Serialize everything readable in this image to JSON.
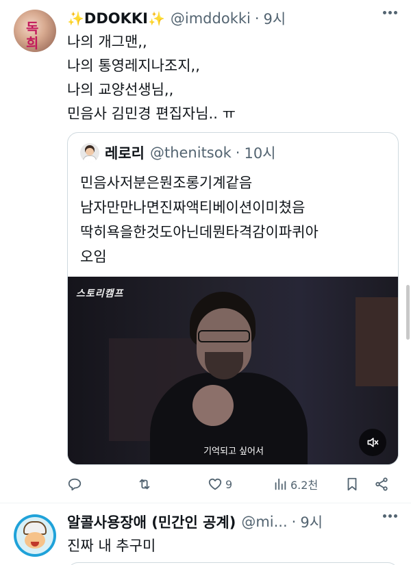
{
  "tweet1": {
    "name": "DDOKKI",
    "name_prefix_emoji": "✨",
    "name_suffix_emoji": "✨",
    "handle": "@imddokki",
    "separator": "·",
    "time": "9시",
    "avatar_text": "독\n희",
    "lines": [
      "나의 개그맨,,",
      "나의 통영레지나조지,,",
      "나의 교양선생님,,",
      "민음사 김민경 편집자님.. ㅠ"
    ],
    "quote": {
      "name": "레로리",
      "handle": "@thenitsok",
      "separator": "·",
      "time": "10시",
      "lines": [
        "민음사저분은뭔조롱기계같음",
        "남자만만나면진짜액티베이션이미쳤음",
        "딱히욕을한것도아닌데뭔타격감이파퀴아",
        "오임"
      ],
      "video": {
        "logo": "스토리캠프",
        "caption": "기억되고 싶어서",
        "mute_icon": "speaker-muted-icon"
      }
    },
    "actions": {
      "reply_icon": "reply-icon",
      "retweet_icon": "retweet-icon",
      "like_icon": "heart-icon",
      "like_count": "9",
      "views_icon": "views-chart-icon",
      "views_count": "6.2천",
      "bookmark_icon": "bookmark-icon",
      "share_icon": "share-icon"
    }
  },
  "tweet2": {
    "name": "알콜사용장애 (민간인 공계)",
    "handle": "@mi...",
    "separator": "·",
    "time": "9시",
    "text": "진짜 내 추구미"
  },
  "colors": {
    "text": "#0f1419",
    "secondary": "#536471",
    "border": "#cfd9de",
    "sparkle": "#f2b51f"
  }
}
